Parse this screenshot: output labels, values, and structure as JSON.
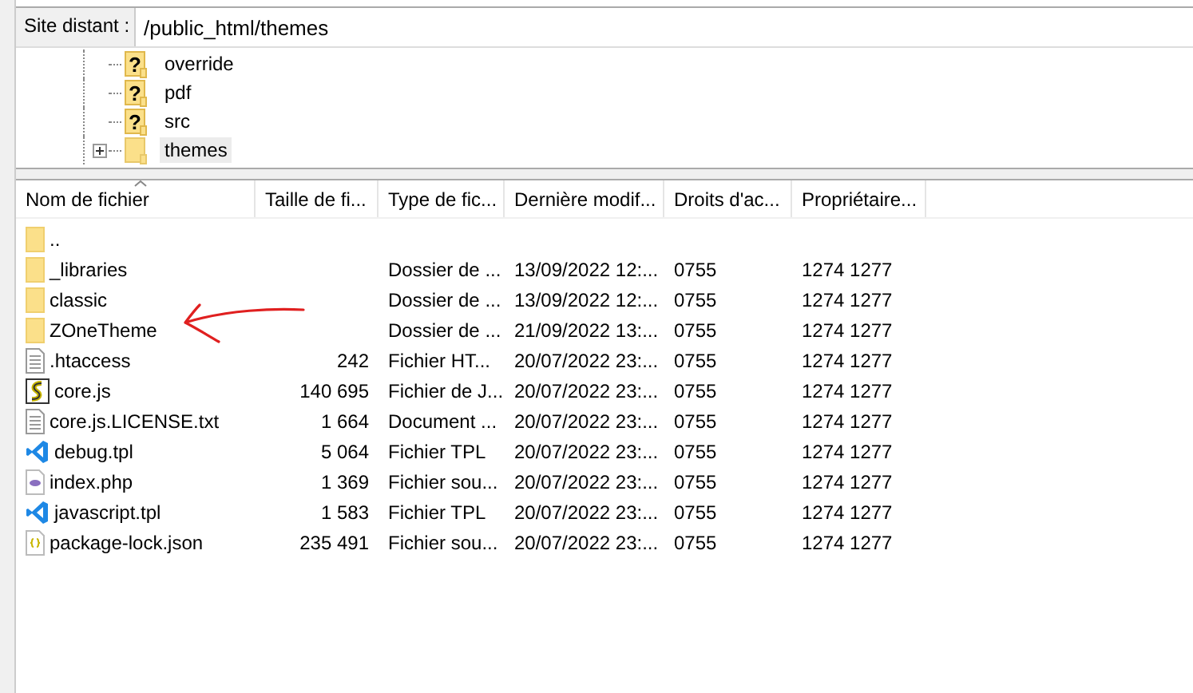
{
  "remote_site": {
    "label": "Site distant :",
    "path": "/public_html/themes"
  },
  "tree": [
    {
      "name": "override",
      "kind": "unknown",
      "icon": "?",
      "expandable": false,
      "selected": false
    },
    {
      "name": "pdf",
      "kind": "unknown",
      "icon": "?",
      "expandable": false,
      "selected": false
    },
    {
      "name": "src",
      "kind": "unknown",
      "icon": "?",
      "expandable": false,
      "selected": false
    },
    {
      "name": "themes",
      "kind": "folder",
      "expandable": true,
      "selected": true
    }
  ],
  "table": {
    "columns": [
      "Nom de fichier",
      "Taille de fi...",
      "Type de fic...",
      "Dernière modif...",
      "Droits d'ac...",
      "Propriétaire..."
    ],
    "rows": [
      {
        "kind": "folder",
        "name": "..",
        "size": "",
        "type": "",
        "modified": "",
        "rights": "",
        "owner": ""
      },
      {
        "kind": "folder",
        "name": "_libraries",
        "type": "Dossier de ...",
        "modified": "13/09/2022 12:...",
        "rights": "0755",
        "owner": "1274 1277"
      },
      {
        "kind": "folder",
        "name": "classic",
        "type": "Dossier de ...",
        "modified": "13/09/2022 12:...",
        "rights": "0755",
        "owner": "1274 1277"
      },
      {
        "kind": "folder",
        "name": "ZOneTheme",
        "type": "Dossier de ...",
        "modified": "21/09/2022 13:...",
        "rights": "0755",
        "owner": "1274 1277"
      },
      {
        "kind": "text",
        "name": ".htaccess",
        "size": "242",
        "type": "Fichier HT...",
        "modified": "20/07/2022 23:...",
        "rights": "0755",
        "owner": "1274 1277"
      },
      {
        "kind": "script",
        "name": "core.js",
        "size": "140 695",
        "type": "Fichier de J...",
        "modified": "20/07/2022 23:...",
        "rights": "0755",
        "owner": "1274 1277"
      },
      {
        "kind": "text",
        "name": "core.js.LICENSE.txt",
        "size": "1 664",
        "type": "Document ...",
        "modified": "20/07/2022 23:...",
        "rights": "0755",
        "owner": "1274 1277"
      },
      {
        "kind": "code",
        "name": "debug.tpl",
        "size": "5 064",
        "type": "Fichier TPL",
        "modified": "20/07/2022 23:...",
        "rights": "0755",
        "owner": "1274 1277"
      },
      {
        "kind": "php",
        "name": "index.php",
        "size": "1 369",
        "type": "Fichier sou...",
        "modified": "20/07/2022 23:...",
        "rights": "0755",
        "owner": "1274 1277"
      },
      {
        "kind": "code",
        "name": "javascript.tpl",
        "size": "1 583",
        "type": "Fichier TPL",
        "modified": "20/07/2022 23:...",
        "rights": "0755",
        "owner": "1274 1277"
      },
      {
        "kind": "json",
        "name": "package-lock.json",
        "size": "235 491",
        "type": "Fichier sou...",
        "modified": "20/07/2022 23:...",
        "rights": "0755",
        "owner": "1274 1277"
      }
    ]
  }
}
